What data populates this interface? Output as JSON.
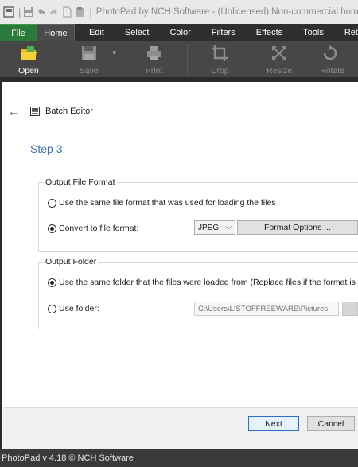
{
  "titlebar": {
    "title": "PhotoPad by NCH Software - (Unlicensed) Non-commercial home"
  },
  "menu": {
    "tabs": [
      "File",
      "Home",
      "Edit",
      "Select",
      "Color",
      "Filters",
      "Effects",
      "Tools",
      "Ret"
    ]
  },
  "toolbar": {
    "open": "Open",
    "save": "Save",
    "print": "Print",
    "crop": "Crop",
    "resize": "Resize",
    "rotate": "Rotate"
  },
  "dialog": {
    "breadcrumb": "Batch Editor",
    "step": "Step 3:",
    "output_format": {
      "legend": "Output File Format",
      "option_same": "Use the same file format that was used for loading the files",
      "option_convert": "Convert to file format:",
      "format_value": "JPEG",
      "format_options_button": "Format Options ..."
    },
    "output_folder": {
      "legend": "Output Folder",
      "option_same": "Use the same folder that the files were loaded from (Replace files if the format is the sa",
      "option_use": "Use folder:",
      "folder_path": "C:\\Users\\LISTOFFREEWARE\\Pictures"
    },
    "next_button": "Next",
    "cancel_button": "Cancel"
  },
  "statusbar": {
    "text": "PhotoPad v 4.18 © NCH Software"
  }
}
